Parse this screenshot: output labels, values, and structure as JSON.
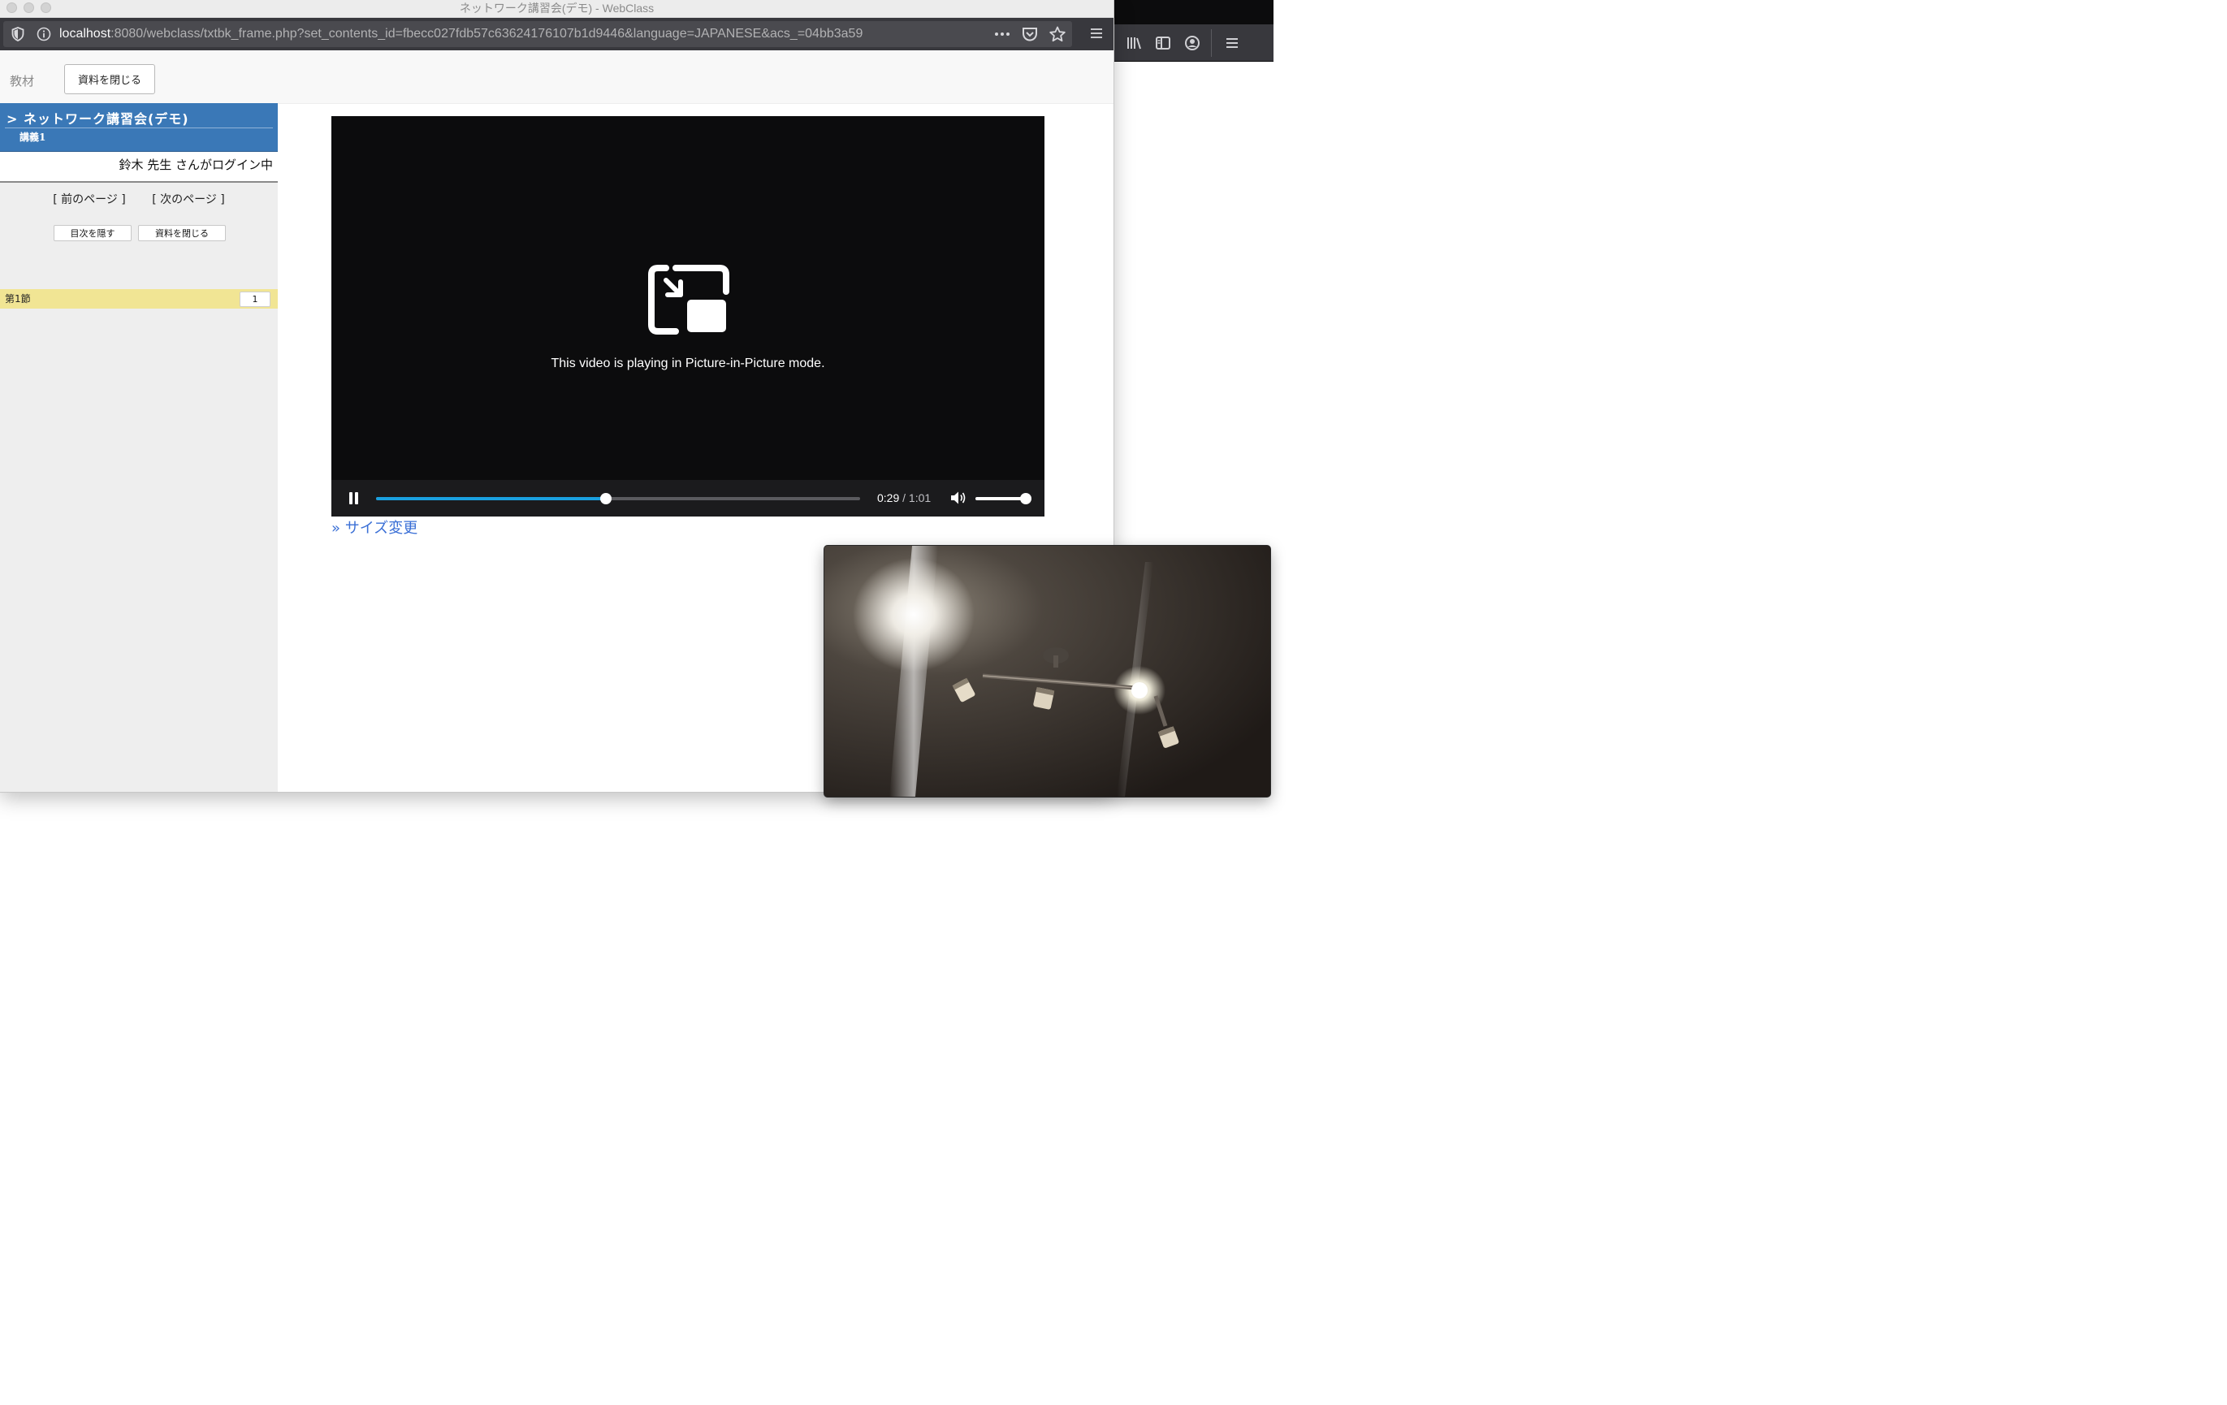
{
  "window": {
    "title": "ネットワーク講習会(デモ) - WebClass"
  },
  "browser": {
    "url_host": "localhost",
    "url_rest": ":8080/webclass/txtbk_frame.php?set_contents_id=fbecc027fdb57c63624176107b1d9446&language=JAPANESE&acs_=04bb3a59",
    "icons": [
      "shield-icon",
      "info-icon",
      "more-icon",
      "pocket-icon",
      "bookmark-star-icon",
      "menu-icon",
      "library-icon",
      "sidebar-icon",
      "account-icon"
    ]
  },
  "top_strip": {
    "label": "教材",
    "close_button": "資料を閉じる"
  },
  "sidebar": {
    "course_title": "> ネットワーク講習会(デモ)",
    "lecture": "講義1",
    "login_status": "鈴木 先生 さんがログイン中",
    "prev_page": "[ 前のページ ]",
    "next_page": "[ 次のページ ]",
    "hide_toc_button": "目次を隠す",
    "close_material_button": "資料を閉じる",
    "section": {
      "name": "第1節",
      "page": "1"
    }
  },
  "video": {
    "pip_message": "This video is playing in Picture-in-Picture mode.",
    "current_time": "0:29",
    "total_time": "/ 1:01",
    "progress": 0.4754,
    "volume": 1.0,
    "accent_color": "#1aa0e0"
  },
  "resize_link": "» サイズ変更",
  "colors": {
    "course_header": "#3a78b7",
    "section_highlight": "#f1e594",
    "link": "#3a6fd6"
  }
}
